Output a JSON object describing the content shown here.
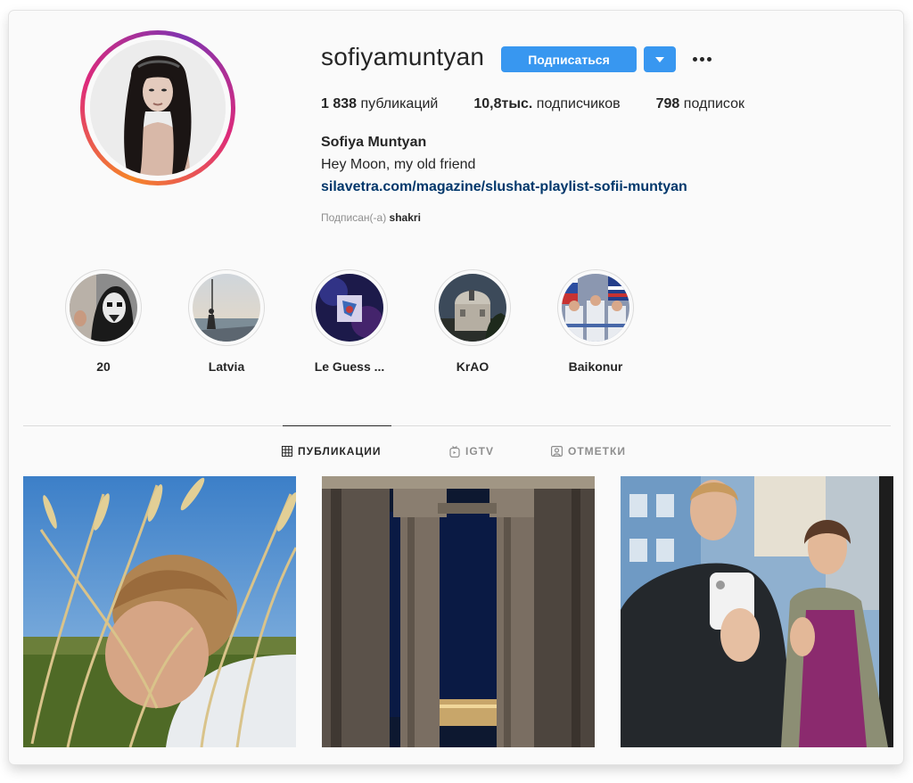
{
  "profile": {
    "username": "sofiyamuntyan",
    "follow_label": "Подписаться",
    "stats": {
      "posts_value": "1 838",
      "posts_label": "публикаций",
      "followers_value": "10,8тыс.",
      "followers_label": "подписчиков",
      "following_value": "798",
      "following_label": "подписок"
    },
    "full_name": "Sofiya Muntyan",
    "bio": "Hey Moon, my old friend",
    "link": "silavetra.com/magazine/slushat-playlist-sofii-muntyan",
    "followed_by_label": "Подписан(-а)",
    "followed_by_user": "shakri"
  },
  "highlights": [
    {
      "label": "20",
      "icon": "highlight-cover"
    },
    {
      "label": "Latvia",
      "icon": "highlight-cover"
    },
    {
      "label": "Le Guess ...",
      "icon": "highlight-cover"
    },
    {
      "label": "KrAO",
      "icon": "highlight-cover"
    },
    {
      "label": "Baikonur",
      "icon": "highlight-cover"
    }
  ],
  "tabs": [
    {
      "label": "ПУБЛИКАЦИИ",
      "icon": "grid-icon",
      "active": true
    },
    {
      "label": "IGTV",
      "icon": "igtv-icon",
      "active": false
    },
    {
      "label": "ОТМЕТКИ",
      "icon": "tagged-icon",
      "active": false
    }
  ],
  "colors": {
    "accent": "#3897f0",
    "link": "#00376b",
    "muted": "#8e8e8e",
    "text": "#262626",
    "background": "#fafafa"
  }
}
